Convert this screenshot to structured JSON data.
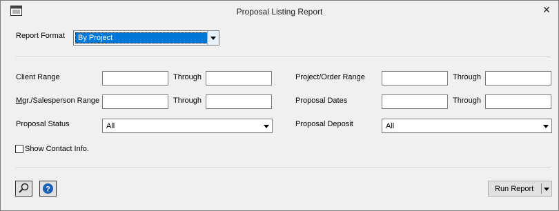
{
  "window": {
    "title": "Proposal Listing Report",
    "close_glyph": "✕",
    "app_icon": "window-app-icon"
  },
  "report_format": {
    "label": "Report Format",
    "value": "By Project"
  },
  "left": {
    "client_range": {
      "label": "Client Range",
      "from": "",
      "through_label": "Through",
      "to": ""
    },
    "mgr_range": {
      "label_prefix": "M",
      "label_rest": "gr./Salesperson Range",
      "from": "",
      "through_label": "Through",
      "to": ""
    },
    "proposal_status": {
      "label": "Proposal Status",
      "value": "All"
    }
  },
  "right": {
    "project_range": {
      "label": "Project/Order Range",
      "from": "",
      "through_label": "Through",
      "to": ""
    },
    "proposal_dates": {
      "label": "Proposal Dates",
      "from": "",
      "through_label": "Through",
      "to": ""
    },
    "proposal_deposit": {
      "label": "Proposal Deposit",
      "value": "All"
    }
  },
  "show_contact": {
    "label": "Show Contact Info.",
    "checked": false
  },
  "footer": {
    "preview_icon": "magnifier-icon",
    "help_icon": "help-icon",
    "run_label": "Run Report"
  },
  "colors": {
    "selection": "#0078d7",
    "help_blue": "#1a5fb4"
  }
}
